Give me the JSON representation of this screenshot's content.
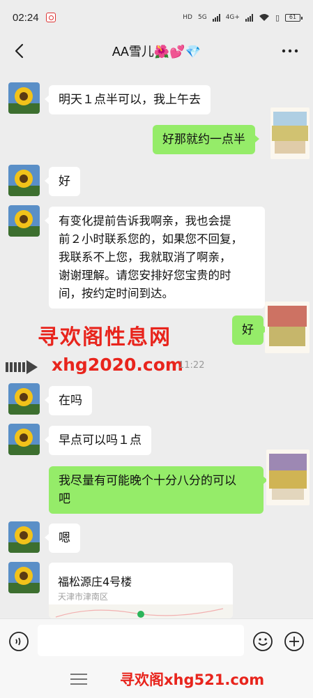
{
  "status_bar": {
    "time": "02:24",
    "network_hd": "HD",
    "network_5g": "5G",
    "network_4g": "4G+",
    "battery": "61"
  },
  "header": {
    "title": "AA雪儿🌺💕💎"
  },
  "messages": [
    {
      "side": "left",
      "text": "明天１点半可以，我上午去"
    },
    {
      "side": "right",
      "text": "好那就约一点半"
    },
    {
      "side": "left",
      "text": "好"
    },
    {
      "side": "left",
      "lines": [
        "有变化提前告诉我啊亲，我也会提",
        "前２小时联系您的，如果您不回复，",
        "我联系不上您，我就取消了啊亲，",
        "谢谢理解。请您安排好您宝贵的时",
        "间，按约定时间到达。"
      ]
    },
    {
      "side": "right",
      "text": "好"
    },
    {
      "side": "left",
      "text": "在吗"
    },
    {
      "side": "left",
      "text": "早点可以吗１点"
    },
    {
      "side": "right",
      "lines": [
        "我尽量有可能晚个十分八分的可以",
        "吧"
      ]
    },
    {
      "side": "left",
      "text": "嗯"
    }
  ],
  "timestamp": "11:22",
  "location": {
    "name": "福松源庄4号楼",
    "address": "天津市津南区"
  },
  "watermarks": {
    "middle_title": "寻欢阁性息网",
    "middle_url": "xhg2020.com",
    "bottom": "寻欢阁xhg521.com"
  },
  "colors": {
    "own_bubble": "#95ec69",
    "other_bubble": "#ffffff",
    "background": "#ededed",
    "watermark": "#e8241c"
  }
}
